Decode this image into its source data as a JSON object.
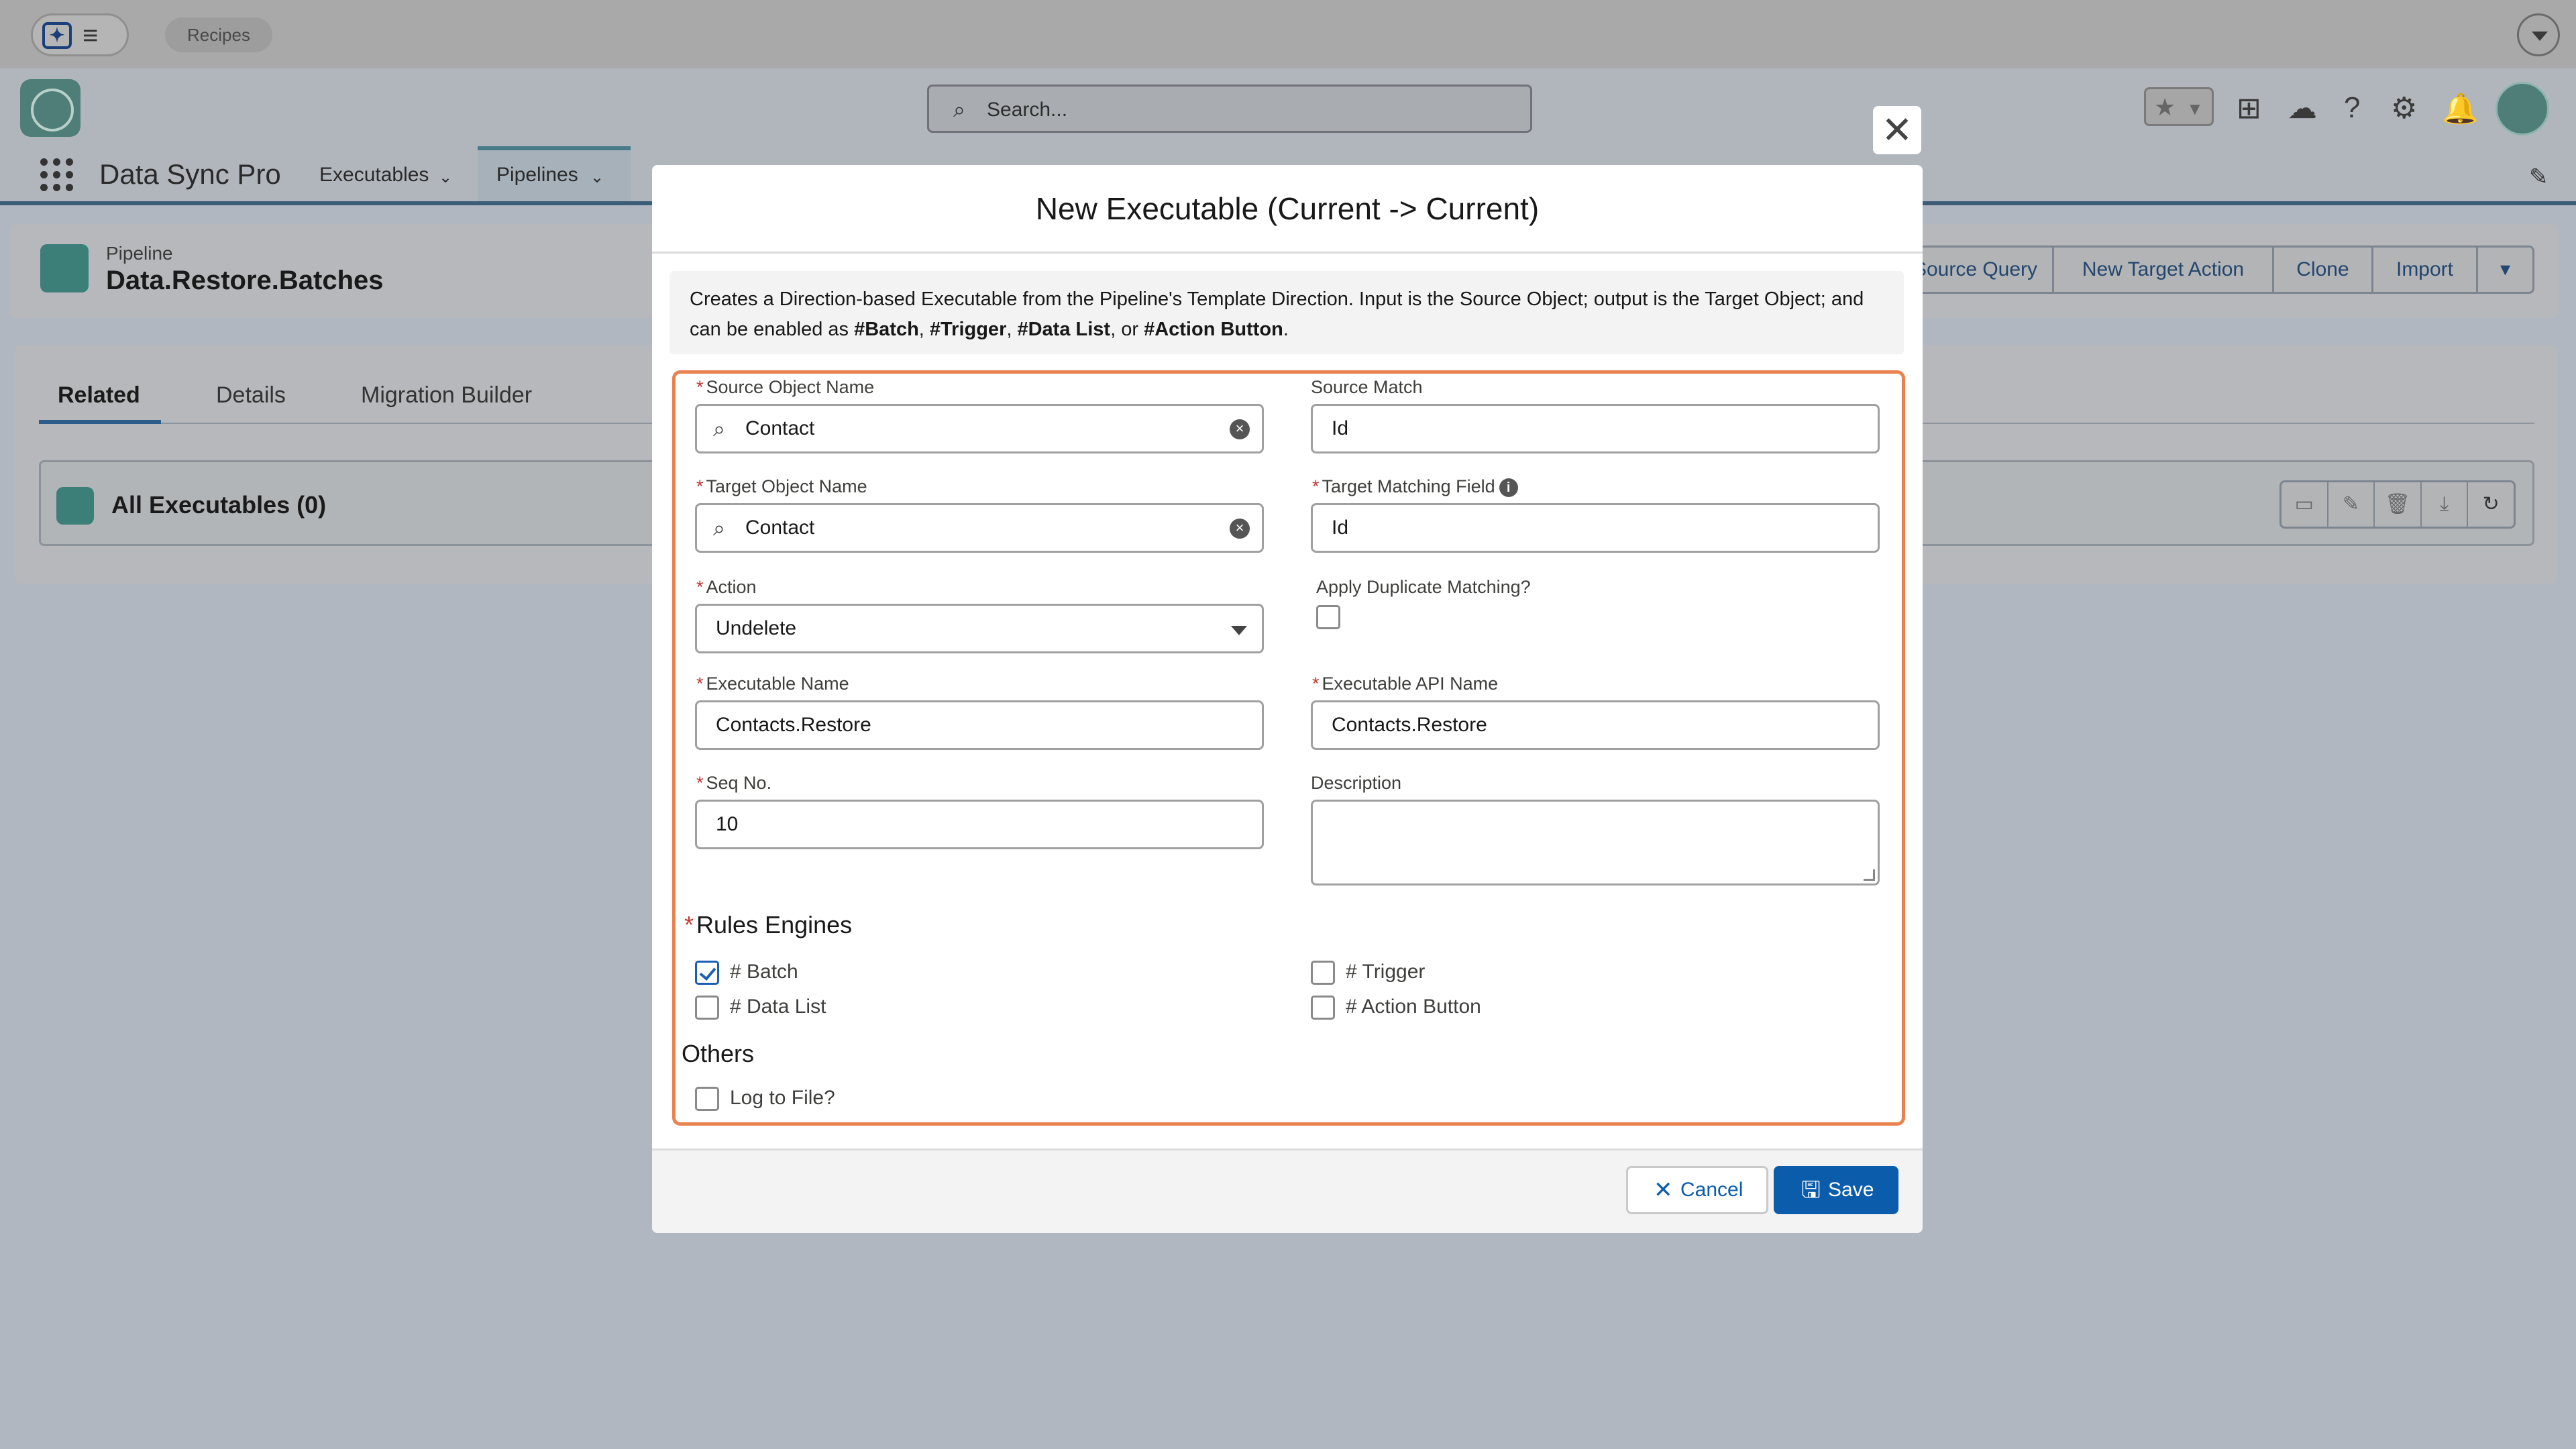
{
  "topbar": {
    "recipes_label": "Recipes"
  },
  "header": {
    "search_placeholder": "Search..."
  },
  "nav": {
    "app_name": "Data Sync Pro",
    "items": [
      {
        "label": "Executables"
      },
      {
        "label": "Pipelines"
      }
    ]
  },
  "record": {
    "object_label": "Pipeline",
    "name": "Data.Restore.Batches",
    "actions": [
      "Source Query",
      "New Target Action",
      "Clone",
      "Import"
    ]
  },
  "tabs": [
    "Related",
    "Details",
    "Migration Builder"
  ],
  "related": {
    "executables_title": "All Executables (0)"
  },
  "modal": {
    "title": "New Executable (Current -> Current)",
    "info_prefix": "Creates a Direction-based Executable from the Pipeline's Template Direction. Input is the Source Object; output is the Target Object; and can be enabled as ",
    "info_tags": [
      "#Batch",
      "#Trigger",
      "#Data List",
      "#Action Button"
    ],
    "info_sep1": ", ",
    "info_sep2": ", ",
    "info_sep3": ", or ",
    "info_end": ".",
    "required_mark": "*",
    "fields": {
      "source_object_label": "Source Object Name",
      "source_object_value": "Contact",
      "source_match_label": "Source Match",
      "source_match_value": "Id",
      "target_object_label": "Target Object Name",
      "target_object_value": "Contact",
      "target_matching_label": "Target Matching Field",
      "target_matching_value": "Id",
      "action_label": "Action",
      "action_value": "Undelete",
      "apply_duplicate_label": "Apply Duplicate Matching?",
      "executable_name_label": "Executable Name",
      "executable_name_value": "Contacts.Restore",
      "executable_api_label": "Executable API Name",
      "executable_api_value": "Contacts.Restore",
      "seq_label": "Seq No.",
      "seq_value": "10",
      "description_label": "Description"
    },
    "rules_engines_title": "Rules Engines",
    "rules_engines": {
      "batch": {
        "label": "# Batch",
        "checked": true
      },
      "trigger": {
        "label": "# Trigger",
        "checked": false
      },
      "data_list": {
        "label": "# Data List",
        "checked": false
      },
      "action_button": {
        "label": "# Action Button",
        "checked": false
      }
    },
    "others_title": "Others",
    "log_to_file_label": "Log to File?",
    "cancel_label": "Cancel",
    "save_label": "Save"
  }
}
